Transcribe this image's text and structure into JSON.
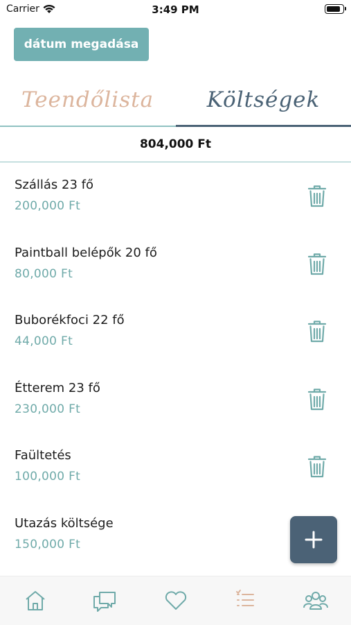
{
  "status_bar": {
    "carrier": "Carrier",
    "time": "3:49 PM"
  },
  "header": {
    "date_button_label": "dátum megadása"
  },
  "tabs": [
    {
      "label": "Teendőlista",
      "active": false
    },
    {
      "label": "Költségek",
      "active": true
    }
  ],
  "total": "804,000 Ft",
  "expenses": [
    {
      "name": "Szállás 23 fő",
      "price": "200,000 Ft"
    },
    {
      "name": "Paintball belépők 20 fő",
      "price": "80,000 Ft"
    },
    {
      "name": "Buborékfoci 22 fő",
      "price": "44,000 Ft"
    },
    {
      "name": "Étterem 23 fő",
      "price": "230,000 Ft"
    },
    {
      "name": "Faültetés",
      "price": "100,000 Ft"
    },
    {
      "name": "Utazás költsége",
      "price": "150,000 Ft"
    }
  ],
  "icons": {
    "delete": "trash-icon",
    "add": "plus-icon",
    "tabbar": [
      "home-icon",
      "chat-icon",
      "heart-icon",
      "list-icon",
      "group-icon"
    ]
  },
  "colors": {
    "accent": "#72b0b2",
    "dark": "#4b6276",
    "active_tab_icon": "#dcb59d"
  }
}
